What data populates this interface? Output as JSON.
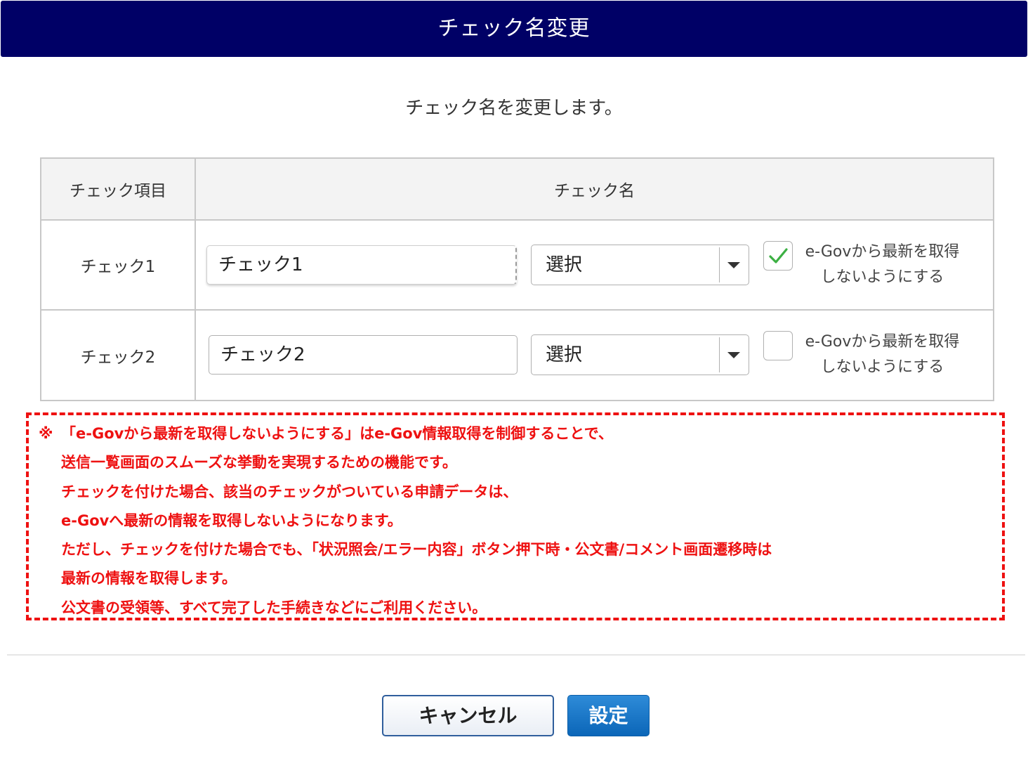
{
  "title": "チェック名変更",
  "subtitle": "チェック名を変更します。",
  "table": {
    "headers": [
      "チェック項目",
      "チェック名"
    ],
    "rows": [
      {
        "item": "チェック1",
        "name_value": "チェック1",
        "select_value": "選択",
        "checkbox_checked": true,
        "checkbox_label_line1": "e-Govから最新を取得",
        "checkbox_label_line2": "しないようにする"
      },
      {
        "item": "チェック2",
        "name_value": "チェック2",
        "select_value": "選択",
        "checkbox_checked": false,
        "checkbox_label_line1": "e-Govから最新を取得",
        "checkbox_label_line2": "しないようにする"
      }
    ]
  },
  "notice": {
    "mark": "※",
    "lines": [
      "「e-Govから最新を取得しないようにする」はe-Gov情報取得を制御することで、",
      "送信一覧画面のスムーズな挙動を実現するための機能です。",
      "チェックを付けた場合、該当のチェックがついている申請データは、",
      "e-Govへ最新の情報を取得しないようになります。",
      "ただし、チェックを付けた場合でも、「状況照会/エラー内容」ボタン押下時・公文書/コメント画面遷移時は",
      "最新の情報を取得します。",
      "公文書の受領等、すべて完了した手続きなどにご利用ください。"
    ]
  },
  "buttons": {
    "cancel": "キャンセル",
    "ok": "設定"
  },
  "colors": {
    "titlebar": "#000066",
    "notice": "#ee1111",
    "check": "#3cb043",
    "ok_button": "#0b66b8"
  }
}
